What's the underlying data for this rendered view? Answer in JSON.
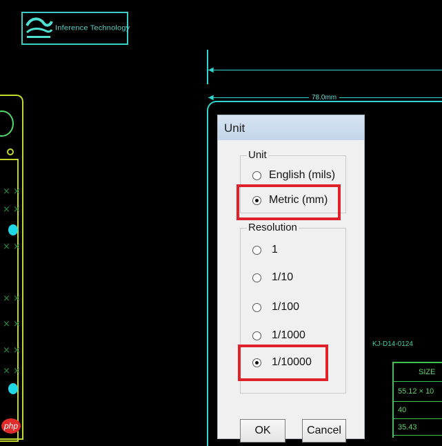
{
  "dialog": {
    "title": "Unit",
    "unit_group": {
      "label": "Unit",
      "options": [
        {
          "label": "English (mils)",
          "selected": false
        },
        {
          "label": "Metric (mm)",
          "selected": true
        }
      ]
    },
    "resolution_group": {
      "label": "Resolution",
      "options": [
        {
          "label": "1",
          "selected": false
        },
        {
          "label": "1/10",
          "selected": false
        },
        {
          "label": "1/100",
          "selected": false
        },
        {
          "label": "1/1000",
          "selected": false
        },
        {
          "label": "1/10000",
          "selected": true
        }
      ]
    },
    "ok_label": "OK",
    "cancel_label": "Cancel"
  },
  "background": {
    "logo_text": "Inference Technology",
    "dimension_label": "78.0mm",
    "part_label": "KJ-D14-0124",
    "table": {
      "header": "SIZE",
      "rows": [
        "55.12 × 10",
        "40",
        "35.43"
      ]
    },
    "watermark": "php"
  },
  "colors": {
    "cad_cyan": "#2fd6cf",
    "pcb_yellow": "#c3d92c",
    "highlight_red": "#e0202a",
    "dialog_bg": "#f0f0f0"
  }
}
